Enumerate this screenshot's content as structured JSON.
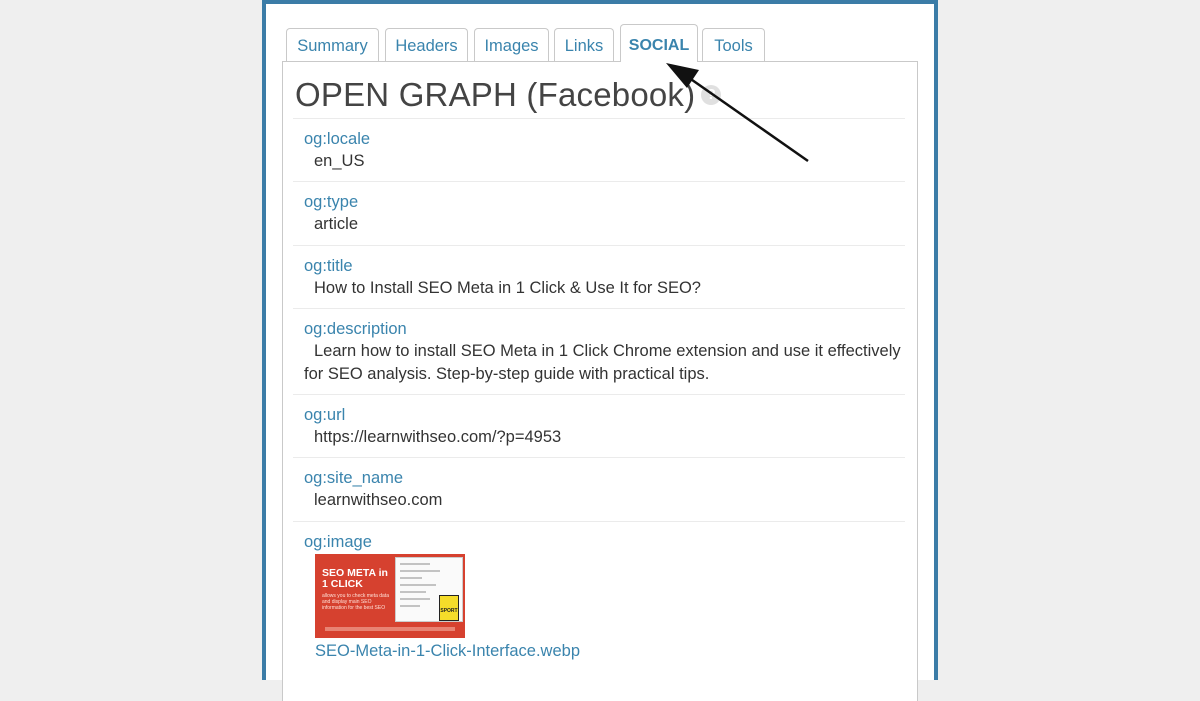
{
  "tabs": [
    {
      "label": "Summary"
    },
    {
      "label": "Headers"
    },
    {
      "label": "Images"
    },
    {
      "label": "Links"
    },
    {
      "label": "SOCIAL",
      "active": true
    },
    {
      "label": "Tools"
    }
  ],
  "heading": "OPEN GRAPH (Facebook)",
  "help_icon": {
    "name": "help-icon",
    "glyph": "?"
  },
  "og": {
    "locale": {
      "key": "og:locale",
      "value": "en_US"
    },
    "type": {
      "key": "og:type",
      "value": "article"
    },
    "title": {
      "key": "og:title",
      "value": "How to Install SEO Meta in 1 Click & Use It for SEO?"
    },
    "description": {
      "key": "og:description",
      "value": "Learn how to install SEO Meta in 1 Click Chrome extension and use it effectively for SEO analysis. Step-by-step guide with practical tips."
    },
    "url": {
      "key": "og:url",
      "value": "https://learnwithseo.com/?p=4953"
    },
    "site_name": {
      "key": "og:site_name",
      "value": "learnwithseo.com"
    },
    "image": {
      "key": "og:image",
      "thumbnail_title": "SEO META in 1 CLICK",
      "thumbnail_text": "allows you to check meta data and display main SEO information for the best SEO",
      "thumbnail_badge": "SPORT",
      "filename": "SEO-Meta-in-1-Click-Interface.webp"
    }
  },
  "colors": {
    "frame": "#3b7ca7",
    "link": "#3a84ad",
    "text": "#333333",
    "heading": "#444444"
  }
}
